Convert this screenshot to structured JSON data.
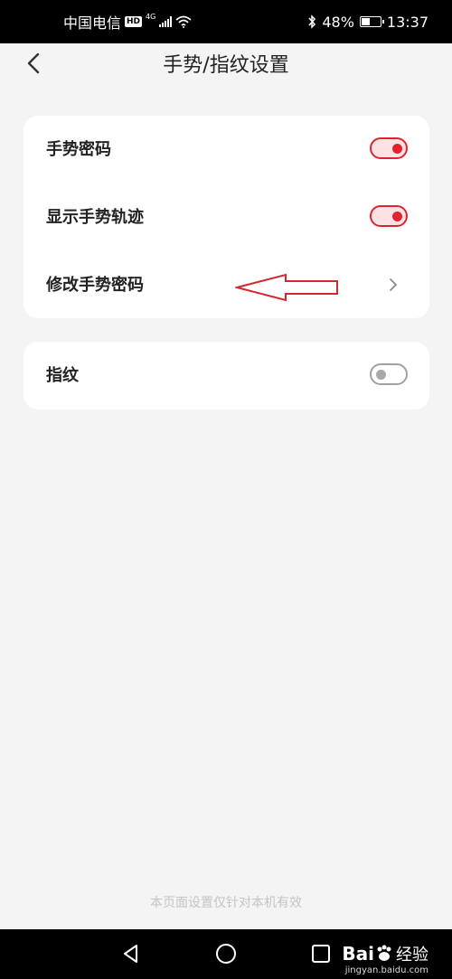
{
  "status_bar": {
    "carrier": "中国电信",
    "hd_badge": "HD",
    "network": "4G",
    "battery": "48%",
    "battery_level": 0.48,
    "time": "13:37"
  },
  "header": {
    "title": "手势/指纹设置"
  },
  "gesture_card": {
    "items": [
      {
        "label": "手势密码",
        "control": "switch",
        "on": true
      },
      {
        "label": "显示手势轨迹",
        "control": "switch",
        "on": true
      },
      {
        "label": "修改手势密码",
        "control": "chevron"
      }
    ]
  },
  "fingerprint_card": {
    "label": "指纹",
    "on": false
  },
  "footer_note": "本页面设置仅针对本机有效",
  "watermark": {
    "logo_text": "Bai",
    "logo_cn": "经验",
    "sub": "jingyan.baidu.com"
  },
  "colors": {
    "accent": "#e02330",
    "annotation_arrow": "#d6262d",
    "background": "#f4f4f4"
  },
  "icons": {
    "back": "chevron-left-icon",
    "chevron": "chevron-right-icon",
    "nav_back": "triangle-back-icon",
    "nav_home": "circle-home-icon",
    "nav_recent": "square-recent-icon",
    "bluetooth": "bluetooth-icon",
    "wifi": "wifi-icon"
  }
}
